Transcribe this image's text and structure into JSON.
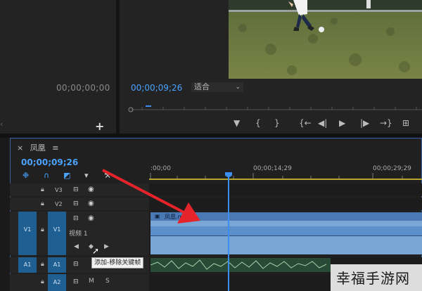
{
  "source_monitor": {
    "timecode": "00;00;00;00",
    "add_label": "+"
  },
  "program_monitor": {
    "timecode": "00;00;09;26",
    "fit": "适合",
    "controls": [
      "▼",
      "{",
      "}",
      "{←",
      "◀|",
      "▶",
      "|▶",
      "→}",
      "⊞"
    ]
  },
  "timeline": {
    "close": "×",
    "sequence_name": "凤凰",
    "menu": "≡",
    "timecode": "00;00;09;26",
    "ruler": [
      ":00;00",
      "00;00;14;29",
      "00;00;29;29"
    ],
    "tracks": {
      "v3": "V3",
      "v2": "V2",
      "v1": "V1",
      "v1_source": "V1",
      "v1_name": "视频 1",
      "a1": "A1",
      "a1_source": "A1",
      "a2": "A2",
      "mute": "M",
      "solo": "S"
    },
    "clip_label": "凤凰.mp4"
  },
  "tooltip": "添加-移除关键帧",
  "watermark": "幸福手游网",
  "colors": {
    "accent": "#4aa3ff",
    "clip": "#7aa6d6",
    "arrow": "#e5232a"
  }
}
